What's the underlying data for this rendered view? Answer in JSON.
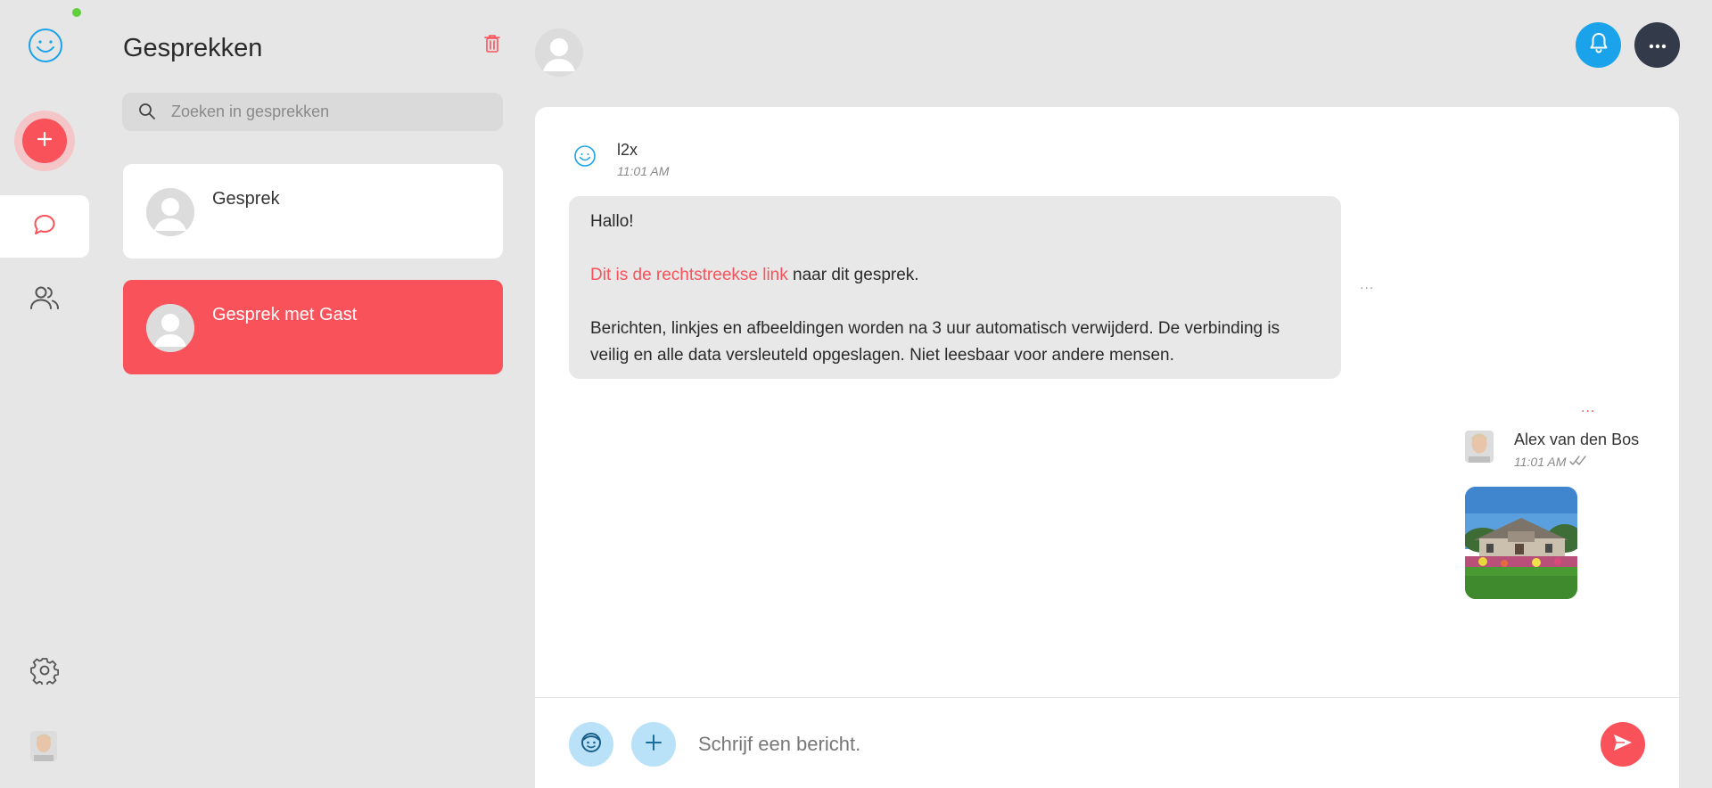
{
  "status": {
    "online_color": "#5fcf3a"
  },
  "rail": {
    "logo_icon": "smiley-logo-icon",
    "new_icon": "plus-icon",
    "items": [
      {
        "icon": "chat-bubble-icon",
        "active": true
      },
      {
        "icon": "users-icon",
        "active": false
      },
      {
        "icon": "gear-icon",
        "active": false
      }
    ]
  },
  "conversations": {
    "title": "Gesprekken",
    "delete_icon": "trash-icon",
    "search_placeholder": "Zoeken in gesprekken",
    "items": [
      {
        "name": "Gesprek",
        "selected": false
      },
      {
        "name": "Gesprek met Gast",
        "selected": true
      }
    ]
  },
  "header": {
    "notification_icon": "bell-icon",
    "menu_icon": "more-dots-icon"
  },
  "chat": {
    "messages": [
      {
        "sender": "l2x",
        "time": "11:01 AM",
        "greeting": "Hallo!",
        "link_text": "Dit is de rechtstreekse link",
        "link_suffix": " naar dit gesprek.",
        "body": "Berichten, linkjes en afbeeldingen worden na 3 uur automatisch verwijderd. De verbinding is veilig en alle data versleuteld opgeslagen. Niet leesbaar voor andere mensen.",
        "menu": "..."
      },
      {
        "sender": "Alex van den Bos",
        "time": "11:01 AM",
        "status_icon": "double-check-icon",
        "attachment": "house-photo",
        "menu": "..."
      }
    ]
  },
  "composer": {
    "placeholder": "Schrijf een bericht.",
    "emoji_icon": "emoji-icon",
    "attach_icon": "plus-icon",
    "send_icon": "send-icon"
  },
  "colors": {
    "accent": "#f9525a",
    "blue": "#1aa3ea",
    "dark": "#333a4a",
    "light_blue": "#b9e2f8"
  }
}
